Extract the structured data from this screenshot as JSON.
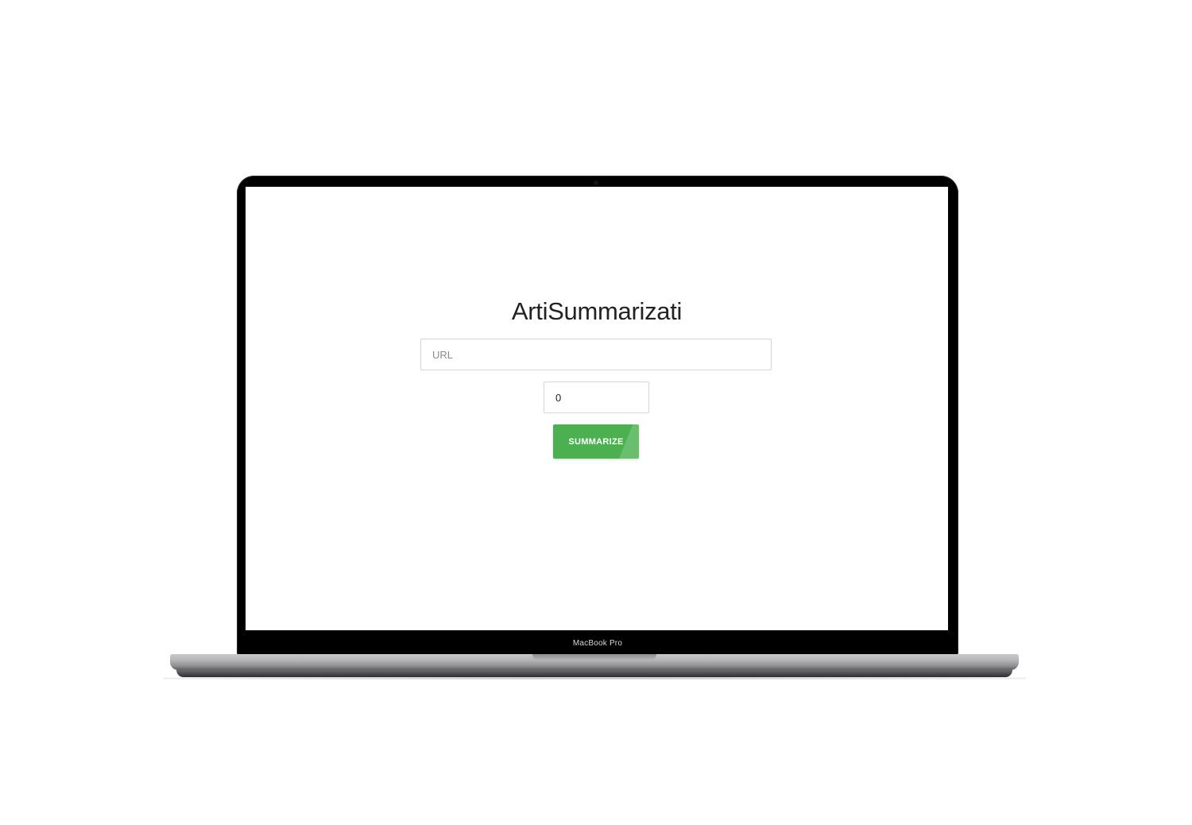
{
  "app": {
    "title": "ArtiSummarizati",
    "url_input": {
      "placeholder": "URL",
      "value": ""
    },
    "count_input": {
      "value": "0"
    },
    "summarize_label": "SUMMARIZE"
  },
  "device": {
    "label": "MacBook Pro"
  },
  "colors": {
    "accent": "#4caf50",
    "title_text": "#222222",
    "bezel": "#000000"
  }
}
